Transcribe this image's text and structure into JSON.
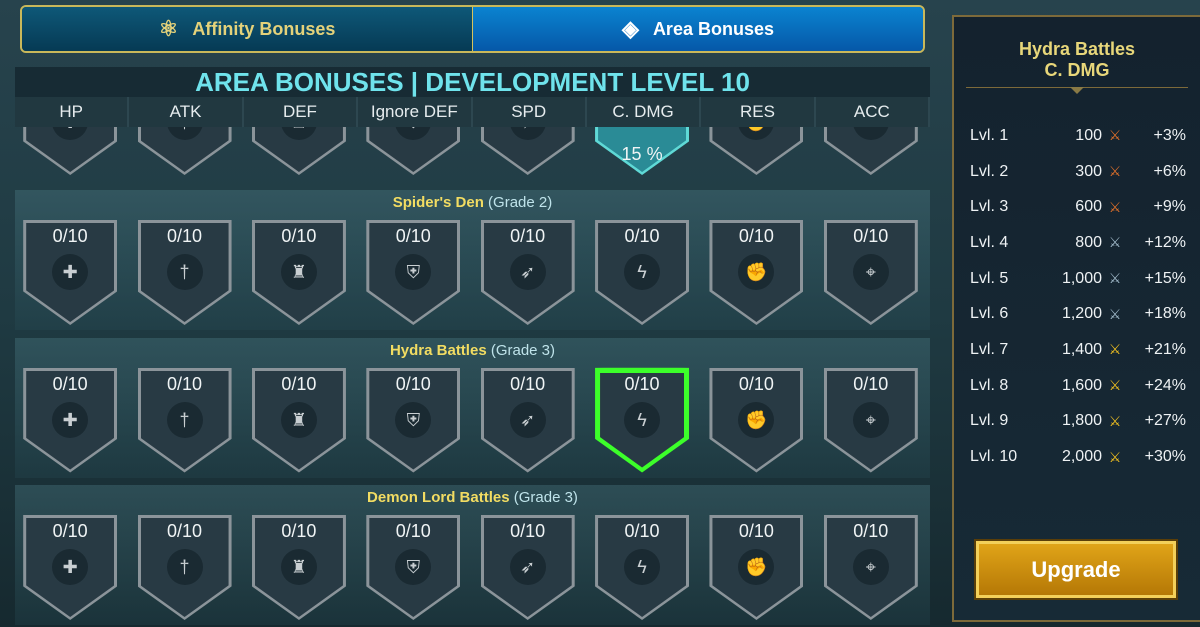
{
  "tabs": [
    {
      "label": "Affinity Bonuses",
      "icon": "affinity-icon"
    },
    {
      "label": "Area Bonuses",
      "icon": "area-icon",
      "active": true
    }
  ],
  "title": "AREA BONUSES | DEVELOPMENT LEVEL 10",
  "columns": [
    "HP",
    "ATK",
    "DEF",
    "Ignore DEF",
    "SPD",
    "C. DMG",
    "RES",
    "ACC"
  ],
  "column_icons": [
    "hp-icon",
    "atk-icon",
    "def-icon",
    "ignore-def-icon",
    "spd-icon",
    "cdmg-icon",
    "res-icon",
    "acc-icon"
  ],
  "column_glyphs": [
    "✚",
    "†",
    "♜",
    "⛨",
    "➶",
    "ϟ",
    "✊",
    "⌖"
  ],
  "top_row": {
    "active_column": 5,
    "active_value": "15 %"
  },
  "sections": [
    {
      "name": "Spider's Den",
      "grade": "(Grade 2)",
      "values": [
        "0/10",
        "0/10",
        "0/10",
        "0/10",
        "0/10",
        "0/10",
        "0/10",
        "0/10"
      ]
    },
    {
      "name": "Hydra Battles",
      "grade": "(Grade 3)",
      "values": [
        "0/10",
        "0/10",
        "0/10",
        "0/10",
        "0/10",
        "0/10",
        "0/10",
        "0/10"
      ],
      "selected_column": 5
    },
    {
      "name": "Demon Lord Battles",
      "grade": "(Grade 3)",
      "values": [
        "0/10",
        "0/10",
        "0/10",
        "0/10",
        "0/10",
        "0/10",
        "0/10",
        "0/10"
      ]
    }
  ],
  "panel": {
    "title1": "Hydra Battles",
    "title2": "C. DMG",
    "levels": [
      {
        "lvl": "Lvl. 1",
        "cost": "100",
        "medal": "bronze",
        "bonus": "+3%"
      },
      {
        "lvl": "Lvl. 2",
        "cost": "300",
        "medal": "bronze",
        "bonus": "+6%"
      },
      {
        "lvl": "Lvl. 3",
        "cost": "600",
        "medal": "bronze",
        "bonus": "+9%"
      },
      {
        "lvl": "Lvl. 4",
        "cost": "800",
        "medal": "silver",
        "bonus": "+12%"
      },
      {
        "lvl": "Lvl. 5",
        "cost": "1,000",
        "medal": "silver",
        "bonus": "+15%"
      },
      {
        "lvl": "Lvl. 6",
        "cost": "1,200",
        "medal": "silver",
        "bonus": "+18%"
      },
      {
        "lvl": "Lvl. 7",
        "cost": "1,400",
        "medal": "gold",
        "bonus": "+21%"
      },
      {
        "lvl": "Lvl. 8",
        "cost": "1,600",
        "medal": "gold",
        "bonus": "+24%"
      },
      {
        "lvl": "Lvl. 9",
        "cost": "1,800",
        "medal": "gold",
        "bonus": "+27%"
      },
      {
        "lvl": "Lvl. 10",
        "cost": "2,000",
        "medal": "gold",
        "bonus": "+30%"
      }
    ],
    "upgrade_label": "Upgrade"
  },
  "colors": {
    "bronze": "#e0702a",
    "silver": "#9fb8c8",
    "gold": "#f0c020",
    "selected": "#3cff2a",
    "title": "#6fe3ec"
  }
}
